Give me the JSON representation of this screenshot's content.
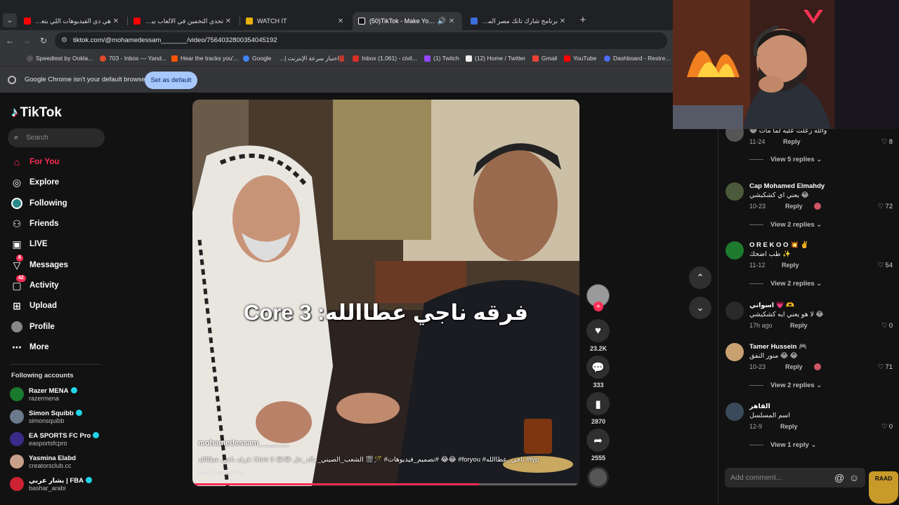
{
  "browser": {
    "tabs": [
      {
        "title": "هي دي الفيديوهات اللي بتعسلل...",
        "favicon_color": "#ff0000",
        "active": false
      },
      {
        "title": "تحدي التخمين في الالعاب بين صـ...",
        "favicon_color": "#ff0000",
        "active": false
      },
      {
        "title": "WATCH IT",
        "favicon_color": "#e8b10c",
        "active": false
      },
      {
        "title": "(50)TikTok - Make Your Day",
        "favicon_color": "#ffffff",
        "active": true
      },
      {
        "title": "برنامج شارك تانك مصر الموسم ال...",
        "favicon_color": "#3b6fe0",
        "active": false
      }
    ],
    "url": "tiktok.com/@mohamedessam_______/video/7564032800354045192",
    "bookmarks": [
      {
        "label": "Speedtest by Ookla...",
        "color": "#333333"
      },
      {
        "label": "703 - Inbox — Yand...",
        "color": "#e24b2b"
      },
      {
        "label": "Hear the tracks you'...",
        "color": "#ff5500"
      },
      {
        "label": "Google",
        "color": "#4285f4"
      },
      {
        "label": "اختبار سرعة الإنترنت |...",
        "color": "#c0392b"
      },
      {
        "label": "Inbox (1,061) - civil...",
        "color": "#d93025"
      },
      {
        "label": "(1) Twitch",
        "color": "#9146ff"
      },
      {
        "label": "(12) Home / Twitter",
        "color": "#ffffff"
      },
      {
        "label": "Gmail",
        "color": "#ea4335"
      },
      {
        "label": "YouTube",
        "color": "#ff0000"
      },
      {
        "label": "Dashboard - Restre...",
        "color": "#4c6ef5"
      }
    ],
    "infobar_message": "Google Chrome isn't your default browser",
    "infobar_button": "Set as default"
  },
  "sidebar": {
    "logo": "TikTok",
    "search_placeholder": "Search",
    "nav": [
      {
        "label": "For You",
        "icon": "home-icon",
        "active": true
      },
      {
        "label": "Explore",
        "icon": "compass-icon"
      },
      {
        "label": "Following",
        "icon": "following-icon"
      },
      {
        "label": "Friends",
        "icon": "friends-icon"
      },
      {
        "label": "LIVE",
        "icon": "live-icon"
      },
      {
        "label": "Messages",
        "icon": "messages-icon",
        "badge": "8"
      },
      {
        "label": "Activity",
        "icon": "activity-icon",
        "badge": "42"
      },
      {
        "label": "Upload",
        "icon": "upload-icon"
      },
      {
        "label": "Profile",
        "icon": "profile-icon"
      },
      {
        "label": "More",
        "icon": "more-icon"
      }
    ],
    "following_title": "Following accounts",
    "following": [
      {
        "name": "Razer MENA",
        "handle": "razermena",
        "verified": true,
        "color": "#1a7a2e"
      },
      {
        "name": "Simon Squibb",
        "handle": "simonsquibb",
        "verified": true,
        "color": "#6a7a8a"
      },
      {
        "name": "EA SPORTS FC Pro",
        "handle": "easportsfcpro",
        "verified": true,
        "color": "#3b2a8a"
      },
      {
        "name": "Yasmina Elabd",
        "handle": "creatorsclub.cc",
        "verified": false,
        "color": "#c9a08a"
      },
      {
        "name": "بشار عربي | FBA",
        "handle": "bashar_arabi",
        "verified": true,
        "color": "#cc2233"
      }
    ]
  },
  "video": {
    "overlay_text": "فرقه ناجي عطاالله: Core 3",
    "username": "mohamedessam_______",
    "caption": "فرقه ناجي عطاالله: Core 3 😂😂 تصميم_فيديوهات# 🪄🎬 الشعب_الصيني_ماله_حل# 😂😂 #foryou #ناجي_عطاالله #fyp",
    "see_translation": "See translation",
    "progress": 0.74,
    "likes": "23.2K",
    "comments": "333",
    "saves": "2870",
    "shares": "2555"
  },
  "comments": [
    {
      "name": "",
      "text": "والله زعلت عليه لما مات 😂",
      "date": "11-24",
      "likes": "8",
      "replies": "View 5 replies",
      "color": "#555555"
    },
    {
      "name": "Cap Mohamed Elmahdy",
      "text": "يعني اي كشكيشي 😂",
      "date": "10-23",
      "likes": "72",
      "replies": "View 2 replies",
      "color": "#4a5a3a",
      "author_liked": true
    },
    {
      "name": "O R E K O O 💥 ✌️",
      "text": "طب اضحك ✨",
      "date": "11-12",
      "likes": "54",
      "replies": "View 2 replies",
      "color": "#1d7a2e"
    },
    {
      "name": "اسواني 💗 🫶",
      "text": "لا هو يعني ايه كشكيشي 😂",
      "date": "17h ago",
      "likes": "0",
      "replies": "",
      "color": "#2a2a2a"
    },
    {
      "name": "Tamer Hussein 🎮",
      "text": "منور النفق 😂 😂",
      "date": "10-23",
      "likes": "71",
      "replies": "View 2 replies",
      "color": "#c9a070",
      "author_liked": true
    },
    {
      "name": "القاهر",
      "text": "اسم المسلسل",
      "date": "12-9",
      "likes": "0",
      "replies": "View 1 reply",
      "color": "#3a4a5a"
    }
  ],
  "reply_label": "Reply",
  "add_comment_placeholder": "Add comment...",
  "webcam_logo": "RAAD"
}
